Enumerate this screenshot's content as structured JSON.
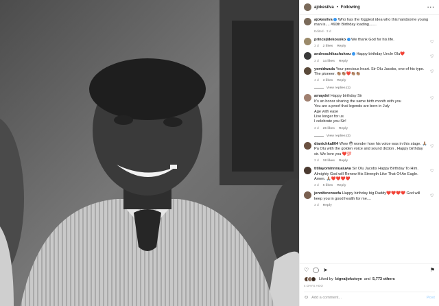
{
  "post": {
    "username": "ajokesilva",
    "follow_label": "Following",
    "more_icon": "more-options-icon",
    "caption": {
      "username": "ajokesilva",
      "text": "Who has the foggiest idea who this handsome young man is.... #60th Birthday loading.......",
      "meta": "Edited · 3 d"
    }
  },
  "comments": [
    {
      "username": "princejidekosoko",
      "text": "We thank God for his life.",
      "time": "3 d",
      "likes": "2 likes",
      "reply": "Reply",
      "avatar_color": "#9b8a6a"
    },
    {
      "username": "andreachikachukwu",
      "text": "Happy birthday Uncle Olu❤️",
      "time": "3 d",
      "likes": "14 likes",
      "reply": "Reply",
      "avatar_color": "#3a3a3a"
    },
    {
      "username": "yemidwada",
      "text": "Your precious heart. Sir Olu Jacobs, one of his type. The pioneer. 👏🏽👏🏽❤️👏🏽👏🏽",
      "time": "4 d",
      "likes": "3 likes",
      "reply": "Reply",
      "view_replies": "View replies (1)",
      "avatar_color": "#5a4a3a"
    },
    {
      "username": "amaydel",
      "lines": [
        "Happy birthday Sir",
        "It's an honor sharing the same birth month with you",
        "You are a proof that legends are born in July",
        "Age with ease",
        "Live longer for us",
        "I celebrate you Sir!"
      ],
      "time": "3 d",
      "likes": "26 likes",
      "reply": "Reply",
      "view_replies": "View replies (2)",
      "avatar_color": "#a08070"
    },
    {
      "username": "dianichka804",
      "text": "Wow 😳 wonder how his voice was in this stage. 🙏🏽Pa Olu with the golden voice and sound diction . Happy birthday sir. We love you ❤️💯",
      "time": "3 d",
      "likes": "18 likes",
      "reply": "Reply",
      "avatar_color": "#6a5040"
    },
    {
      "username": "titilayominnnuaiuwa",
      "text": "Sir Olu Jacobs Happy Birthday To Him. Almighty God will Renew His Strength Like That Of An Eagle. Amen. 🙏🏽❤️❤️❤️❤️",
      "time": "3 d",
      "likes": "5 likes",
      "reply": "Reply",
      "avatar_color": "#4a3a30"
    },
    {
      "username": "jenniferenwefa",
      "text": "Happy birthday big Daddy❤️❤️❤️❤️ God will keep you in good health for me....",
      "time": "3 d",
      "reply": "Reply",
      "avatar_color": "#7a6050"
    }
  ],
  "actions": {
    "liked_prefix": "Liked by",
    "liked_user": "bigvaijokstoye",
    "liked_and": "and",
    "liked_others": "5,773 others",
    "date": "4 DAYS AGO"
  },
  "add_comment": {
    "placeholder": "Add a comment...",
    "post_label": "Post"
  }
}
